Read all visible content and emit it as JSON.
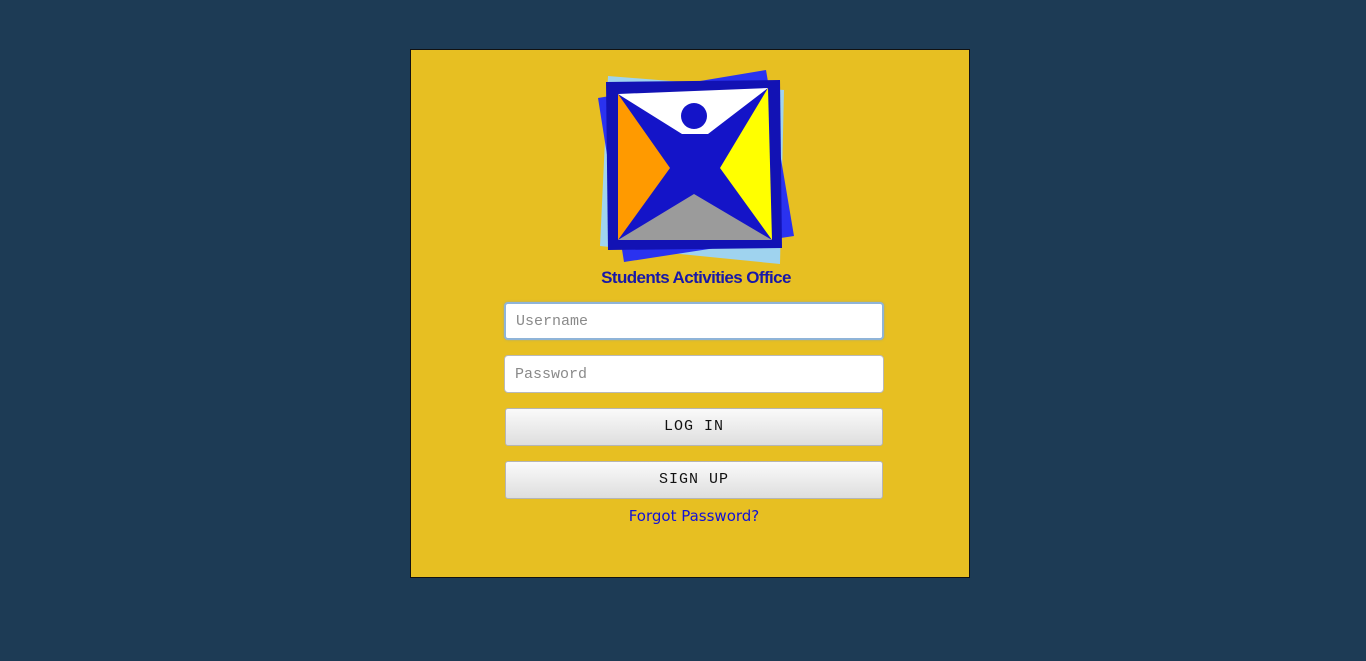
{
  "login": {
    "brand_name": "Students Activities Office",
    "username": {
      "value": "",
      "placeholder": "Username"
    },
    "password": {
      "value": "",
      "placeholder": "Password"
    },
    "login_label": "LOG IN",
    "signup_label": "SIGN UP",
    "forgot_label": "Forgot Password?"
  },
  "colors": {
    "page_background": "#1d3b55",
    "card_background": "#e7bf22",
    "logo_blue": "#1414c8",
    "link": "#1212d6"
  }
}
